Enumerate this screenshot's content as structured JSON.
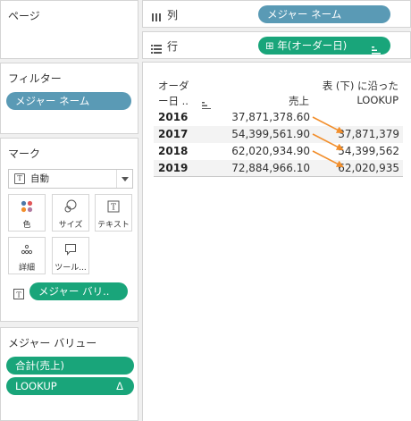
{
  "pages_card": {
    "title": "ページ"
  },
  "filters_card": {
    "title": "フィルター",
    "pill": "メジャー ネーム"
  },
  "marks_card": {
    "title": "マーク",
    "mark_type": "自動",
    "buttons": [
      {
        "label": "色",
        "icon": "color-dots-icon"
      },
      {
        "label": "サイズ",
        "icon": "size-icon"
      },
      {
        "label": "テキスト",
        "icon": "text-icon"
      },
      {
        "label": "詳細",
        "icon": "detail-icon"
      },
      {
        "label": "ツール...",
        "icon": "tooltip-icon"
      }
    ],
    "text_pill": "メジャー バリ.."
  },
  "measure_values_card": {
    "title": "メジャー バリュー",
    "pills": [
      {
        "label": "合計(売上)"
      },
      {
        "label": "LOOKUP",
        "delta": "Δ"
      }
    ]
  },
  "columns_shelf": {
    "label": "列",
    "icon": "columns-icon",
    "pill": "メジャー ネーム"
  },
  "rows_shelf": {
    "label": "行",
    "icon": "rows-icon",
    "pill_prefix": "⊞",
    "pill": "年(オーダー日)"
  },
  "table": {
    "header": {
      "col1_line1": "オーダ",
      "col1_line2": "ー日 ..",
      "col2": "売上",
      "col3_line1": "表 (下) に沿った",
      "col3_line2": "LOOKUP"
    },
    "rows": [
      {
        "year": "2016",
        "sales": "37,871,378.60",
        "lookup": "37,871,379"
      },
      {
        "year": "2017",
        "sales": "54,399,561.90",
        "lookup": "37,871,379"
      },
      {
        "year": "2018",
        "sales": "62,020,934.90",
        "lookup": "54,399,562"
      },
      {
        "year": "2019",
        "sales": "72,884,966.10",
        "lookup": "62,020,935"
      }
    ]
  },
  "colors": {
    "blue_pill": "#5a9ab5",
    "green_pill": "#19a57a",
    "arrow": "#f28e2b"
  }
}
